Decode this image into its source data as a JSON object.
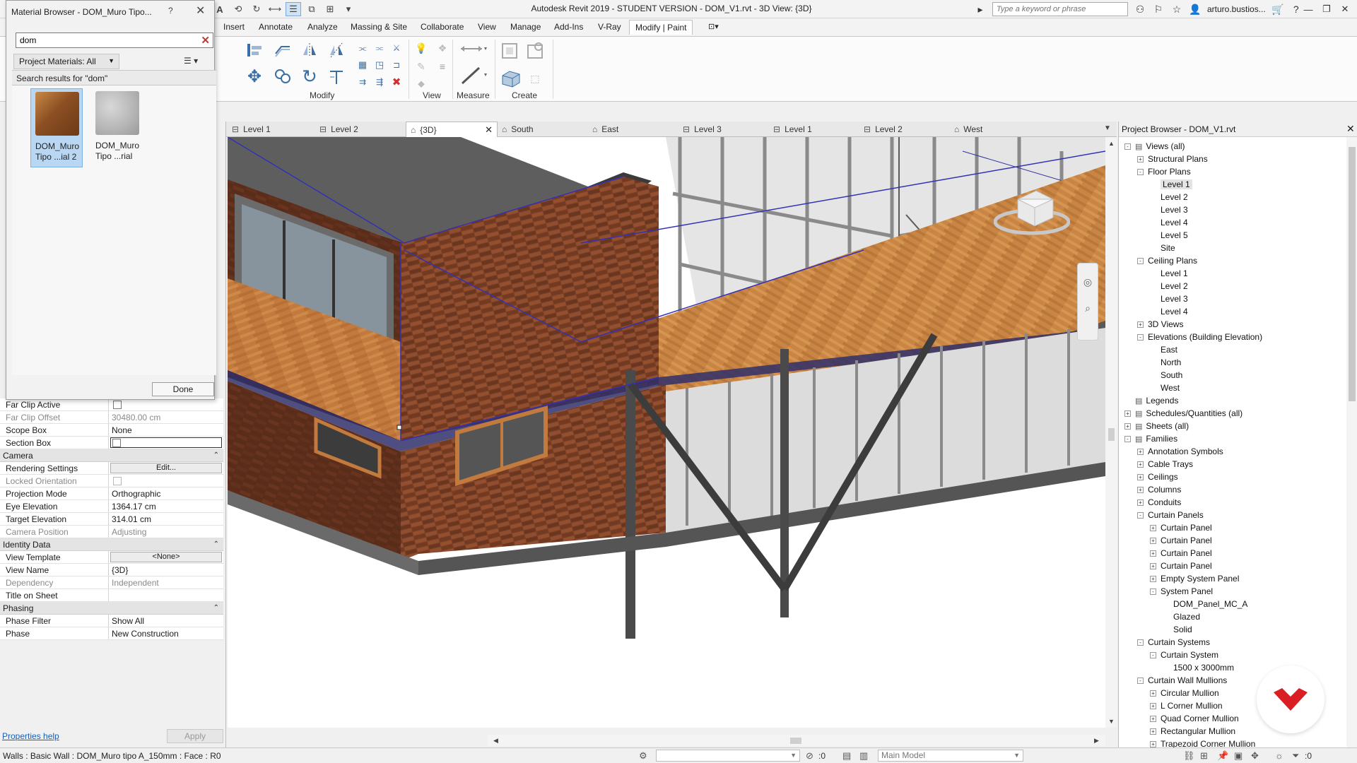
{
  "app": {
    "title": "Autodesk Revit 2019 - STUDENT VERSION - DOM_V1.rvt - 3D View: {3D}",
    "keyword_search_placeholder": "Type a keyword or phrase",
    "username": "arturo.bustios...",
    "accent_color": "#3a6ea5"
  },
  "ribbon": {
    "tabs": [
      "Insert",
      "Annotate",
      "Analyze",
      "Massing & Site",
      "Collaborate",
      "View",
      "Manage",
      "Add-Ins",
      "V-Ray",
      "Modify | Paint"
    ],
    "active_tab": "Modify | Paint",
    "panels": {
      "modify": "Modify",
      "view": "View",
      "measure": "Measure",
      "create": "Create"
    }
  },
  "view_tabs": [
    {
      "label": "Level 1",
      "icon": "floor-plan-icon"
    },
    {
      "label": "Level 2",
      "icon": "floor-plan-icon"
    },
    {
      "label": "{3D}",
      "icon": "3d-view-icon",
      "active": true
    },
    {
      "label": "South",
      "icon": "elevation-icon"
    },
    {
      "label": "East",
      "icon": "elevation-icon"
    },
    {
      "label": "Level 3",
      "icon": "floor-plan-icon"
    },
    {
      "label": "Level 1",
      "icon": "ceiling-plan-icon"
    },
    {
      "label": "Level 2",
      "icon": "ceiling-plan-icon"
    },
    {
      "label": "West",
      "icon": "elevation-icon"
    }
  ],
  "material_browser": {
    "title": "Material Browser - DOM_Muro Tipo...",
    "search_value": "dom",
    "filter_label": "Project Materials: All",
    "results_label": "Search results for \"dom\"",
    "materials": [
      {
        "name_line1": "DOM_Muro",
        "name_line2": "Tipo ...ial 2",
        "kind": "wood",
        "selected": true
      },
      {
        "name_line1": "DOM_Muro",
        "name_line2": "Tipo ...rial",
        "kind": "concrete",
        "selected": false
      }
    ],
    "done_label": "Done"
  },
  "properties": {
    "rows_top": [
      {
        "name": "Far Clip Active",
        "type": "checkbox"
      },
      {
        "name": "Far Clip Offset",
        "value": "30480.00 cm",
        "dim": true
      },
      {
        "name": "Scope Box",
        "value": "None"
      },
      {
        "name": "Section Box",
        "type": "checkbox-outlined"
      }
    ],
    "groups": {
      "camera": "Camera",
      "identity": "Identity Data",
      "phasing": "Phasing"
    },
    "camera": [
      {
        "name": "Rendering Settings",
        "value": "Edit...",
        "type": "button"
      },
      {
        "name": "Locked Orientation",
        "type": "checkbox",
        "dim": true
      },
      {
        "name": "Projection Mode",
        "value": "Orthographic"
      },
      {
        "name": "Eye Elevation",
        "value": "1364.17 cm"
      },
      {
        "name": "Target Elevation",
        "value": "314.01 cm"
      },
      {
        "name": "Camera Position",
        "value": "Adjusting",
        "dim": true
      }
    ],
    "identity": [
      {
        "name": "View Template",
        "value": "<None>",
        "type": "button"
      },
      {
        "name": "View Name",
        "value": "{3D}"
      },
      {
        "name": "Dependency",
        "value": "Independent",
        "dim": true
      },
      {
        "name": "Title on Sheet",
        "value": ""
      }
    ],
    "phasing": [
      {
        "name": "Phase Filter",
        "value": "Show All"
      },
      {
        "name": "Phase",
        "value": "New Construction"
      }
    ],
    "help_label": "Properties help",
    "apply_label": "Apply"
  },
  "project_browser": {
    "title": "Project Browser - DOM_V1.rvt",
    "items": [
      {
        "label": "Views (all)",
        "level": 0,
        "toggle": "-",
        "icon": "views-icon"
      },
      {
        "label": "Structural Plans",
        "level": 1,
        "toggle": "+"
      },
      {
        "label": "Floor Plans",
        "level": 1,
        "toggle": "-"
      },
      {
        "label": "Level 1",
        "level": 2,
        "selected": true
      },
      {
        "label": "Level 2",
        "level": 2
      },
      {
        "label": "Level 3",
        "level": 2
      },
      {
        "label": "Level 4",
        "level": 2
      },
      {
        "label": "Level 5",
        "level": 2
      },
      {
        "label": "Site",
        "level": 2
      },
      {
        "label": "Ceiling Plans",
        "level": 1,
        "toggle": "-"
      },
      {
        "label": "Level 1",
        "level": 2
      },
      {
        "label": "Level 2",
        "level": 2
      },
      {
        "label": "Level 3",
        "level": 2
      },
      {
        "label": "Level 4",
        "level": 2
      },
      {
        "label": "3D Views",
        "level": 1,
        "toggle": "+"
      },
      {
        "label": "Elevations (Building Elevation)",
        "level": 1,
        "toggle": "-"
      },
      {
        "label": "East",
        "level": 2
      },
      {
        "label": "North",
        "level": 2
      },
      {
        "label": "South",
        "level": 2
      },
      {
        "label": "West",
        "level": 2
      },
      {
        "label": "Legends",
        "level": 0,
        "icon": "legends-icon"
      },
      {
        "label": "Schedules/Quantities (all)",
        "level": 0,
        "toggle": "+",
        "icon": "schedules-icon"
      },
      {
        "label": "Sheets (all)",
        "level": 0,
        "toggle": "+",
        "icon": "sheets-icon"
      },
      {
        "label": "Families",
        "level": 0,
        "toggle": "-",
        "icon": "families-icon"
      },
      {
        "label": "Annotation Symbols",
        "level": 1,
        "toggle": "+"
      },
      {
        "label": "Cable Trays",
        "level": 1,
        "toggle": "+"
      },
      {
        "label": "Ceilings",
        "level": 1,
        "toggle": "+"
      },
      {
        "label": "Columns",
        "level": 1,
        "toggle": "+"
      },
      {
        "label": "Conduits",
        "level": 1,
        "toggle": "+"
      },
      {
        "label": "Curtain Panels",
        "level": 1,
        "toggle": "-"
      },
      {
        "label": "Curtain Panel",
        "level": 2,
        "toggle": "+"
      },
      {
        "label": "Curtain Panel",
        "level": 2,
        "toggle": "+"
      },
      {
        "label": "Curtain Panel",
        "level": 2,
        "toggle": "+"
      },
      {
        "label": "Curtain Panel",
        "level": 2,
        "toggle": "+"
      },
      {
        "label": "Empty System Panel",
        "level": 2,
        "toggle": "+"
      },
      {
        "label": "System Panel",
        "level": 2,
        "toggle": "-"
      },
      {
        "label": "DOM_Panel_MC_A",
        "level": 3
      },
      {
        "label": "Glazed",
        "level": 3
      },
      {
        "label": "Solid",
        "level": 3
      },
      {
        "label": "Curtain Systems",
        "level": 1,
        "toggle": "-"
      },
      {
        "label": "Curtain System",
        "level": 2,
        "toggle": "-"
      },
      {
        "label": "1500 x 3000mm",
        "level": 3
      },
      {
        "label": "Curtain Wall Mullions",
        "level": 1,
        "toggle": "-"
      },
      {
        "label": "Circular Mullion",
        "level": 2,
        "toggle": "+"
      },
      {
        "label": "L Corner Mullion",
        "level": 2,
        "toggle": "+"
      },
      {
        "label": "Quad Corner Mullion",
        "level": 2,
        "toggle": "+"
      },
      {
        "label": "Rectangular Mullion",
        "level": 2,
        "toggle": "+"
      },
      {
        "label": "Trapezoid Corner Mullion",
        "level": 2,
        "toggle": "+"
      }
    ]
  },
  "status": {
    "text": "Walls : Basic Wall : DOM_Muro tipo A_150mm : Face : R0",
    "workset_value": ":0",
    "model_label": "Main Model",
    "filter_count": ":0"
  }
}
